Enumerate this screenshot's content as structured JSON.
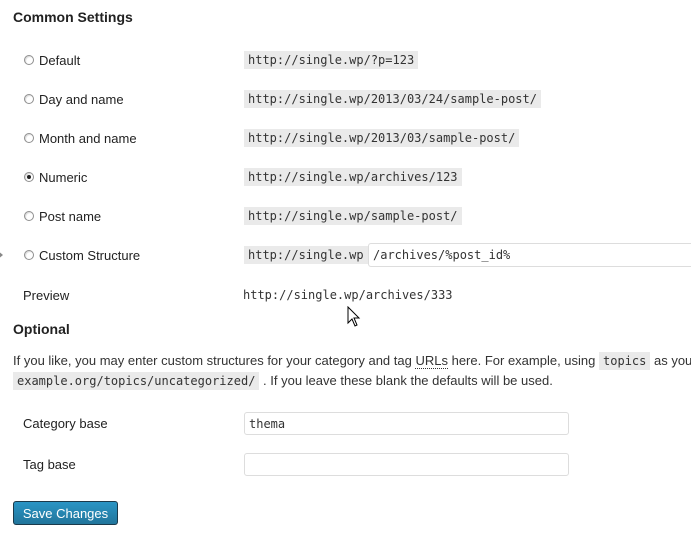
{
  "common": {
    "heading": "Common Settings",
    "options": [
      {
        "label": "Default",
        "example": "http://single.wp/?p=123",
        "checked": false
      },
      {
        "label": "Day and name",
        "example": "http://single.wp/2013/03/24/sample-post/",
        "checked": false
      },
      {
        "label": "Month and name",
        "example": "http://single.wp/2013/03/sample-post/",
        "checked": false
      },
      {
        "label": "Numeric",
        "example": "http://single.wp/archives/123",
        "checked": true
      },
      {
        "label": "Post name",
        "example": "http://single.wp/sample-post/",
        "checked": false
      }
    ],
    "custom": {
      "label": "Custom Structure",
      "prefix": "http://single.wp",
      "value": "/archives/%post_id%",
      "checked": false
    },
    "preview": {
      "label": "Preview",
      "value": "http://single.wp/archives/333"
    }
  },
  "optional": {
    "heading": "Optional",
    "para_part1": "If you like, you may enter custom structures for your category and tag ",
    "para_abbr": "URLs",
    "para_part2": " here. For example, using ",
    "para_code1": "topics",
    "para_part3": " as your category base would make your category links like http://",
    "para_code2": "example.org/topics/uncategorized/",
    "para_part4": " . If you leave these blank the defaults will be used.",
    "category_base": {
      "label": "Category base",
      "value": "thema"
    },
    "tag_base": {
      "label": "Tag base",
      "value": ""
    }
  },
  "save_button": "Save Changes"
}
